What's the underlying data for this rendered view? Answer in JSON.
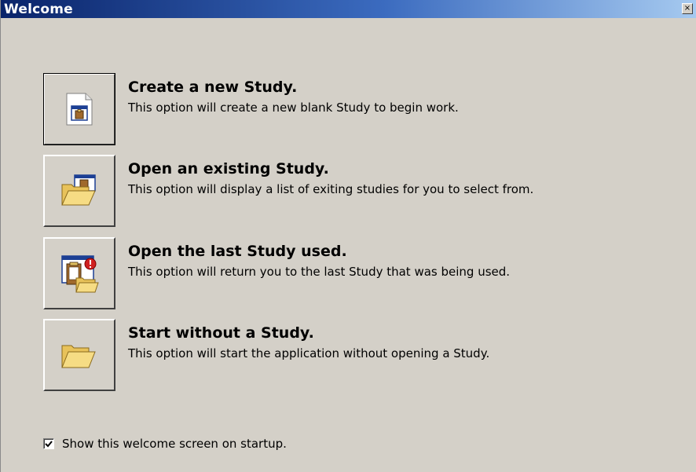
{
  "window": {
    "title": "Welcome",
    "close_glyph": "×"
  },
  "options": [
    {
      "title": "Create a new Study.",
      "description": "This option will create a new blank Study to begin work.",
      "icon": "new-document-icon"
    },
    {
      "title": "Open an existing Study.",
      "description": "This option will display a list of exiting studies for you to select from.",
      "icon": "open-folder-icon"
    },
    {
      "title": "Open the last Study used.",
      "description": "This option will return you to the last Study that was being used.",
      "icon": "recent-study-icon"
    },
    {
      "title": "Start without a Study.",
      "description": "This option will start the application without opening a Study.",
      "icon": "folder-icon"
    }
  ],
  "startup_checkbox": {
    "label": "Show this welcome screen on startup.",
    "checked": true
  },
  "colors": {
    "titlebar_start": "#0a246a",
    "titlebar_end": "#a6caf0",
    "window_bg": "#d4d0c8"
  }
}
